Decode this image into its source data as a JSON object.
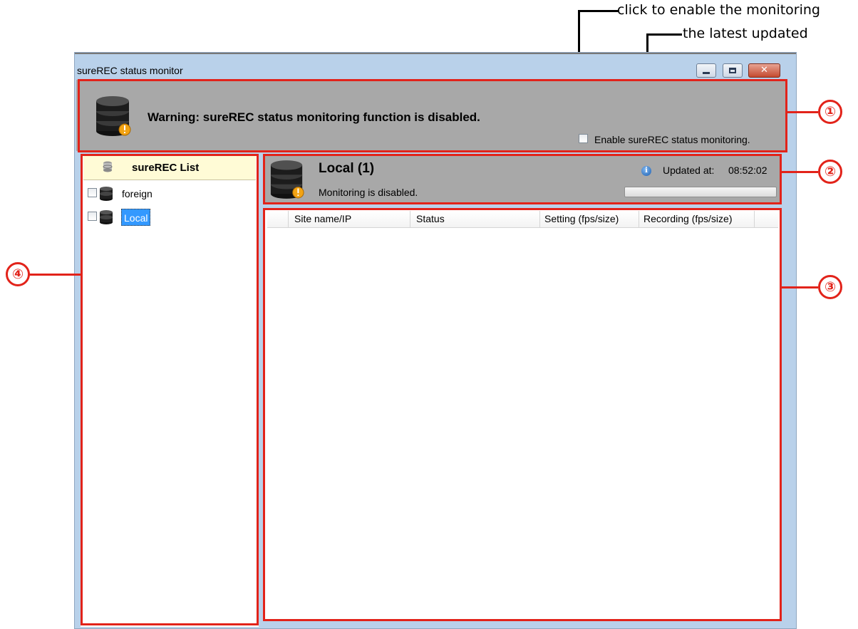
{
  "annotations": {
    "enable_hint": "click to enable the monitoring",
    "updated_hint": "the latest updated",
    "markers": [
      "①",
      "②",
      "③",
      "④"
    ]
  },
  "window": {
    "title": "sureREC status monitor",
    "controls": [
      "minimize-icon",
      "maximize-icon",
      "close-icon"
    ]
  },
  "banner": {
    "warning_text": "Warning: sureREC status monitoring function is disabled.",
    "enable_checkbox_label": "Enable sureREC status monitoring.",
    "enable_checked": false,
    "icon": "database-warning-icon"
  },
  "sidebar": {
    "header": "sureREC List",
    "header_icon": "database-stack-icon",
    "items": [
      {
        "label": "foreign",
        "checked": false,
        "selected": false
      },
      {
        "label": "Local",
        "checked": false,
        "selected": true
      }
    ]
  },
  "detail": {
    "title": "Local (1)",
    "subtitle": "Monitoring is disabled.",
    "updated_label": "Updated at:",
    "updated_time": "08:52:02",
    "info_icon": "info-icon",
    "progress": 0
  },
  "table": {
    "columns": [
      "Site name/IP",
      "Status",
      "Setting (fps/size)",
      "Recording (fps/size)"
    ],
    "rows": []
  },
  "colors": {
    "annotation_red": "#e2231a",
    "panel_gray": "#a8a8a8",
    "window_frame": "#b9d1ea",
    "list_header_bg": "#fffbd6",
    "selection_blue": "#3399ff"
  }
}
